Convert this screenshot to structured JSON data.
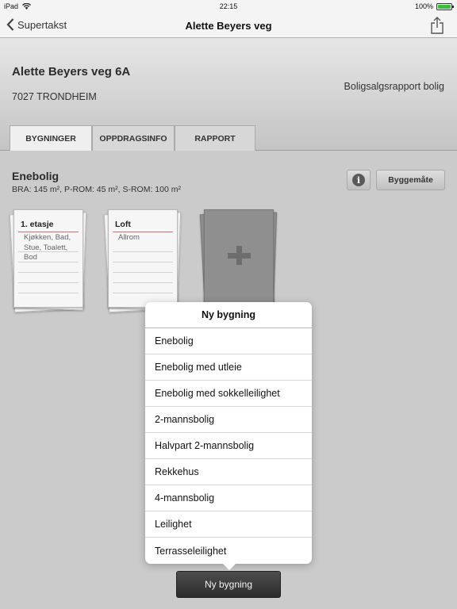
{
  "status_bar": {
    "device": "iPad",
    "time": "22:15",
    "battery_text": "100%",
    "battery_level": 1.0,
    "battery_color": "#36c13a"
  },
  "navbar": {
    "back_label": "Supertakst",
    "title": "Alette Beyers veg"
  },
  "header": {
    "address": "Alette Beyers veg 6A",
    "postal": "7027 TRONDHEIM",
    "report_type": "Boligsalgsrapport bolig"
  },
  "tabs": [
    {
      "label": "BYGNINGER",
      "active": true
    },
    {
      "label": "OPPDRAGSINFO",
      "active": false
    },
    {
      "label": "RAPPORT",
      "active": false
    }
  ],
  "building": {
    "name": "Enebolig",
    "info": "BRA: 145 m², P-ROM: 45 m², S-ROM: 100 m²",
    "info_button_glyph": "i",
    "byggemate_label": "Byggemåte"
  },
  "floors": [
    {
      "title": "1. etasje",
      "rooms": "Kjøkken, Bad, Stue, Toalett, Bod"
    },
    {
      "title": "Loft",
      "rooms": "Allrom"
    }
  ],
  "add_floor_icon": "plus-icon",
  "popover": {
    "title": "Ny bygning",
    "items": [
      "Enebolig",
      "Enebolig med utleie",
      "Enebolig med sokkelleilighet",
      "2-mannsbolig",
      "Halvpart 2-mannsbolig",
      "Rekkehus",
      "4-mannsbolig",
      "Leilighet",
      "Terrasseleilighet"
    ]
  },
  "new_building_button": "Ny bygning"
}
